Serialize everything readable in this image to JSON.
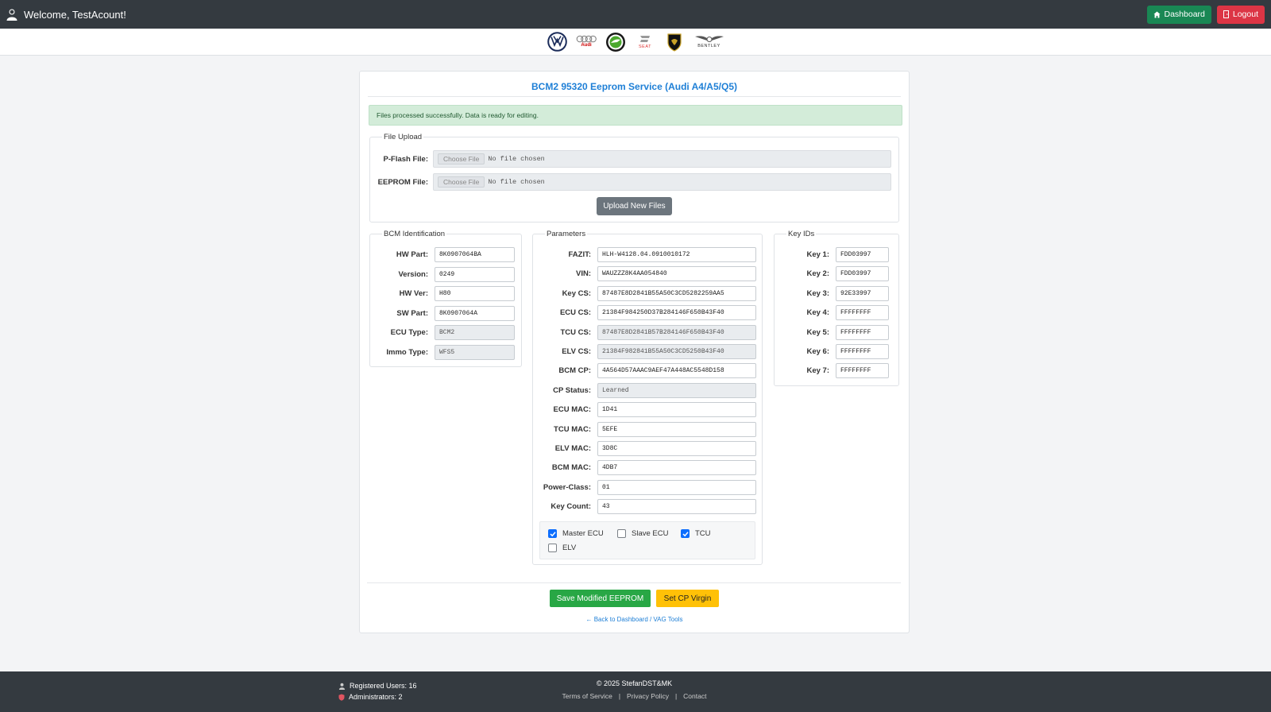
{
  "header": {
    "welcome": "Welcome, TestAcount!",
    "dashboard_label": "Dashboard",
    "logout_label": "Logout"
  },
  "brands": [
    "volkswagen-logo",
    "audi-logo",
    "skoda-logo",
    "seat-logo",
    "lamborghini-logo",
    "bentley-logo"
  ],
  "brand_text": {
    "audi": "Audi",
    "seat": "SEAT",
    "bentley": "BENTLEY"
  },
  "page": {
    "title": "BCM2 95320 Eeprom Service (Audi A4/A5/Q5)",
    "alert": "Files processed successfully. Data is ready for editing."
  },
  "file_upload": {
    "legend": "File Upload",
    "pflash_label": "P-Flash File:",
    "eeprom_label": "EEPROM File:",
    "choose_label": "Choose File",
    "no_file": "No file chosen",
    "upload_button": "Upload New Files"
  },
  "bcm_identification": {
    "legend": "BCM Identification",
    "fields": [
      {
        "label": "HW Part:",
        "value": "8K0907064BA"
      },
      {
        "label": "Version:",
        "value": "0249"
      },
      {
        "label": "HW Ver:",
        "value": "H80"
      },
      {
        "label": "SW Part:",
        "value": "8K0907064A"
      },
      {
        "label": "ECU Type:",
        "value": "BCM2"
      },
      {
        "label": "Immo Type:",
        "value": "WFS5"
      }
    ]
  },
  "parameters": {
    "legend": "Parameters",
    "fields": [
      {
        "label": "FAZIT:",
        "value": "HLH-W4128.04.0910010172"
      },
      {
        "label": "VIN:",
        "value": "WAUZZZ8K4AA054840"
      },
      {
        "label": "Key CS:",
        "value": "87487E8D2841B55A50C3CD5282259AA5"
      },
      {
        "label": "ECU CS:",
        "value": "21384F984250D37B284146F650B43F40"
      },
      {
        "label": "TCU CS:",
        "value": "87487E8D2841B57B284146F650B43F40"
      },
      {
        "label": "ELV CS:",
        "value": "21384F982841B55A50C3CD5250B43F40"
      },
      {
        "label": "BCM CP:",
        "value": "4A564D57AAAC9AEF47A448AC5548D158"
      },
      {
        "label": "CP Status:",
        "value": "Learned"
      },
      {
        "label": "ECU MAC:",
        "value": "1D41"
      },
      {
        "label": "TCU MAC:",
        "value": "5EFE"
      },
      {
        "label": "ELV MAC:",
        "value": "3D8C"
      },
      {
        "label": "BCM MAC:",
        "value": "4DB7"
      },
      {
        "label": "Power-Class:",
        "value": "01"
      },
      {
        "label": "Key Count:",
        "value": "43"
      }
    ],
    "checkboxes": [
      {
        "label": "Master ECU",
        "checked": true
      },
      {
        "label": "Slave ECU",
        "checked": false
      },
      {
        "label": "TCU",
        "checked": true
      },
      {
        "label": "ELV",
        "checked": false
      }
    ]
  },
  "key_ids": {
    "legend": "Key IDs",
    "keys": [
      {
        "label": "Key 1:",
        "value": "FDD03997"
      },
      {
        "label": "Key 2:",
        "value": "FDD03997"
      },
      {
        "label": "Key 3:",
        "value": "92E33997"
      },
      {
        "label": "Key 4:",
        "value": "FFFFFFFF"
      },
      {
        "label": "Key 5:",
        "value": "FFFFFFFF"
      },
      {
        "label": "Key 6:",
        "value": "FFFFFFFF"
      },
      {
        "label": "Key 7:",
        "value": "FFFFFFFF"
      }
    ]
  },
  "actions": {
    "save_label": "Save Modified EEPROM",
    "virgin_label": "Set CP Virgin",
    "back_link": "← Back to Dashboard / VAG Tools"
  },
  "footer": {
    "registered": "Registered Users: 16",
    "admins": "Administrators: 2",
    "copyright": "© 2025 StefanDST&MK",
    "terms": "Terms of Service",
    "privacy": "Privacy Policy",
    "contact": "Contact"
  },
  "colors": {
    "topbar": "#343a40",
    "primary_text": "#1e7fd6",
    "success": "#28a745",
    "danger": "#dc3545",
    "warning": "#ffc107",
    "checkbox": "#0d6efd"
  }
}
